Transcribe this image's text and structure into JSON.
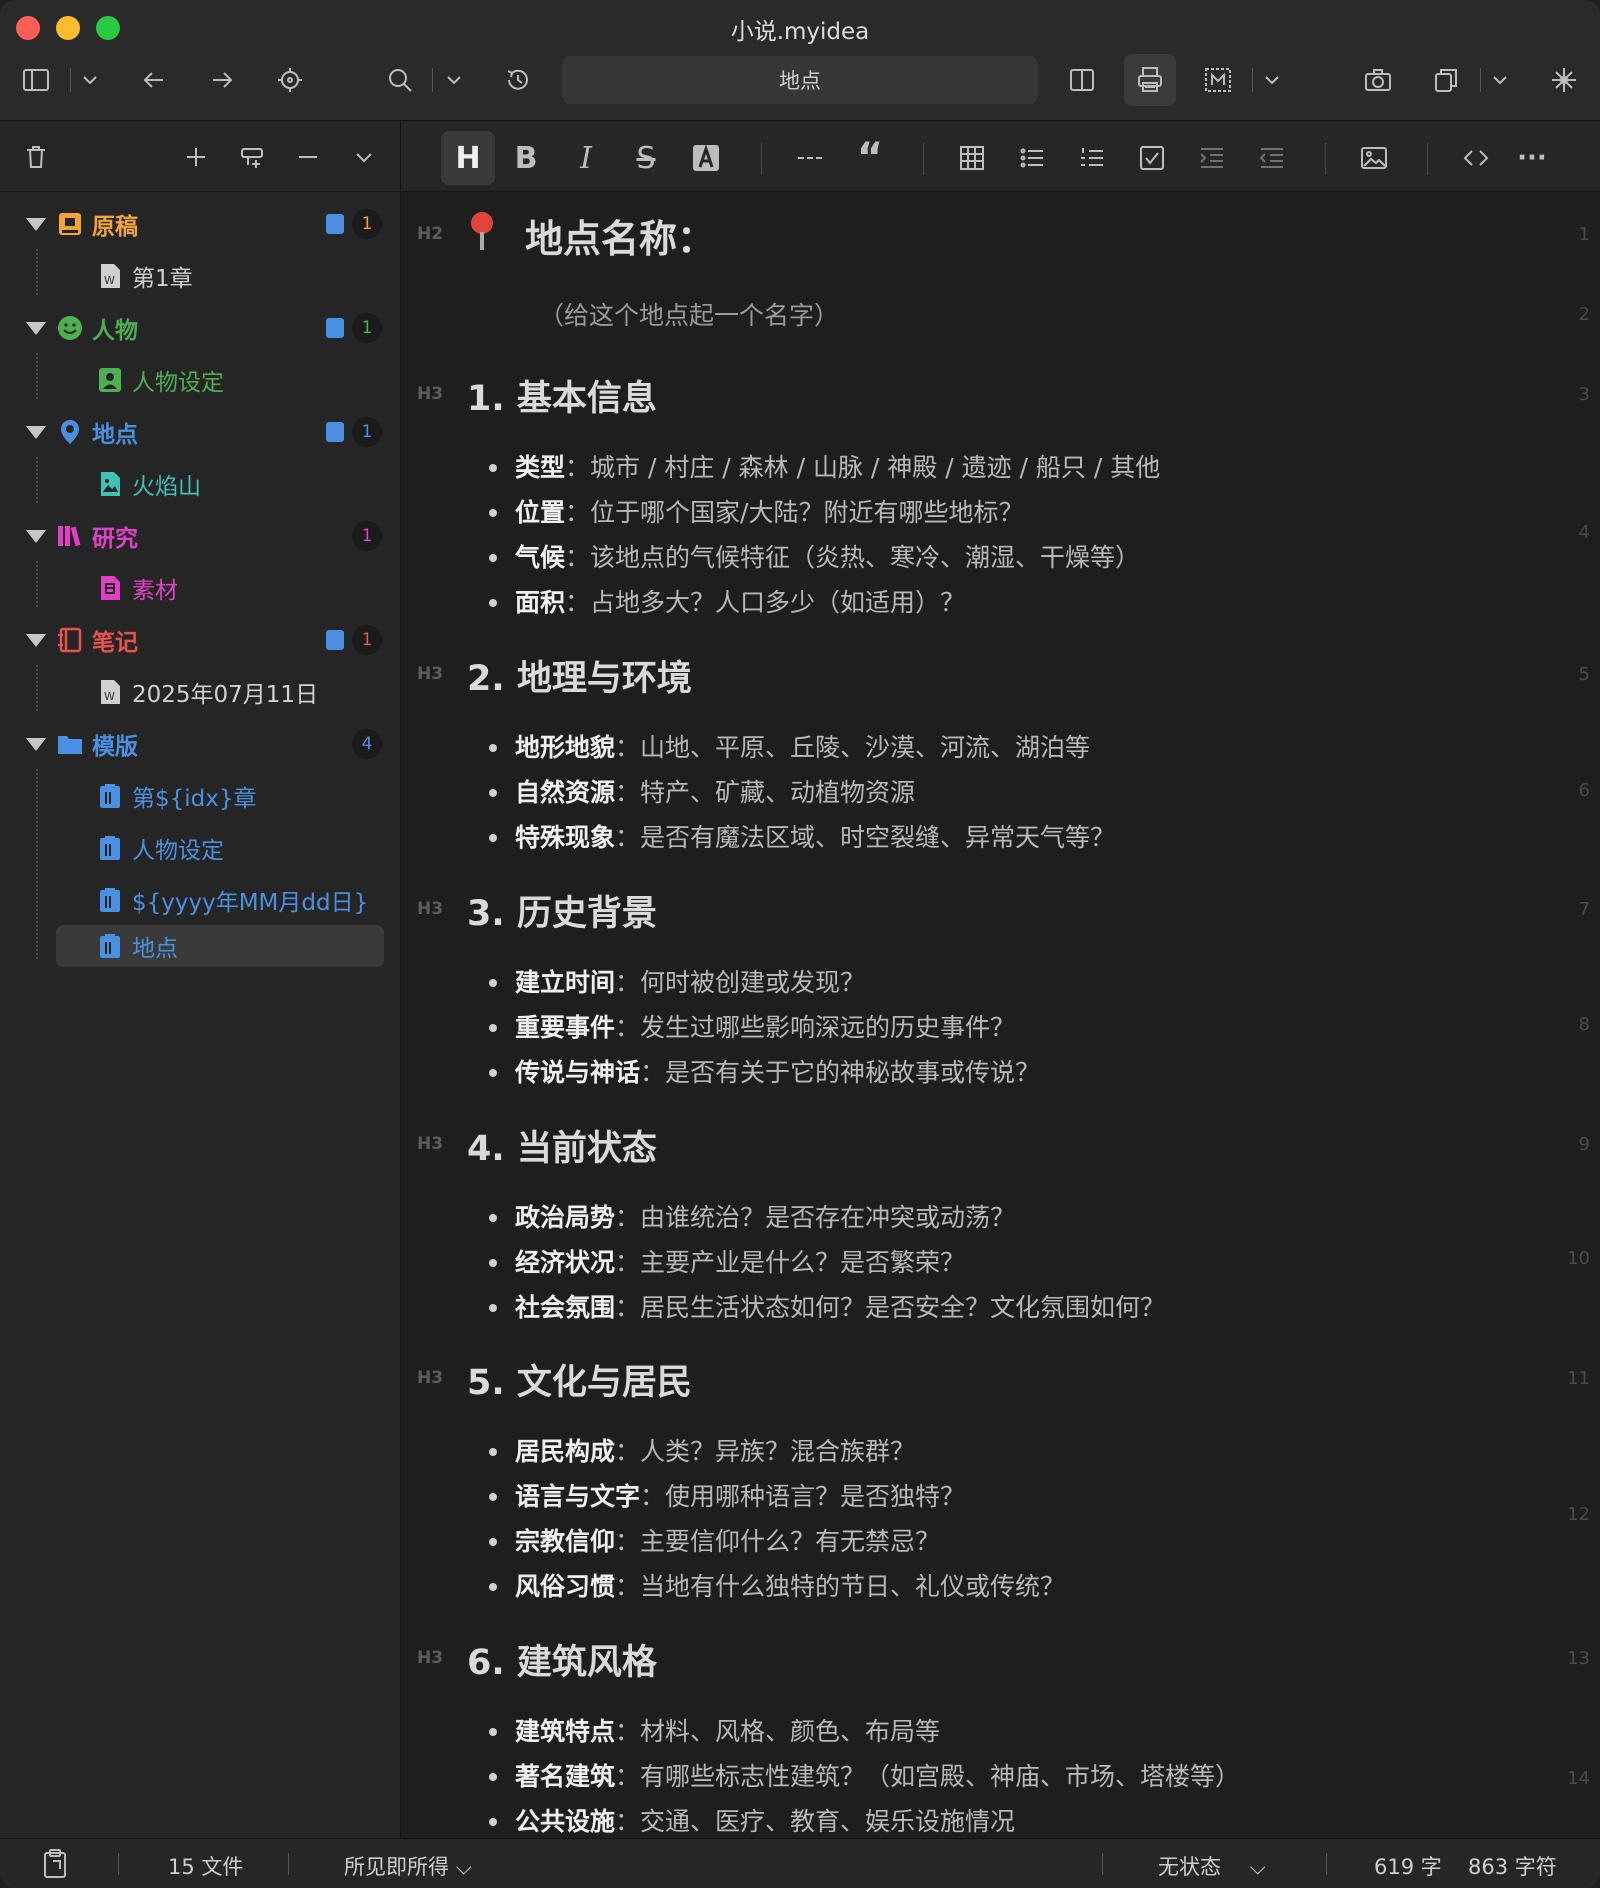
{
  "window": {
    "title": "小说.myidea"
  },
  "toolbar": {
    "search_value": "地点"
  },
  "sidebar": {
    "folders": [
      {
        "label": "原稿",
        "color": "#f2a33a",
        "count": "1",
        "count_color": "#f2a33a",
        "has_note_badge": true,
        "children": [
          {
            "label": "第1章",
            "icon": "doc-icon",
            "color": "#cfcfcf"
          }
        ]
      },
      {
        "label": "人物",
        "color": "#4caf50",
        "count": "1",
        "count_color": "#4caf50",
        "has_note_badge": true,
        "children": [
          {
            "label": "人物设定",
            "icon": "person-icon",
            "color": "#4caf50"
          }
        ]
      },
      {
        "label": "地点",
        "color": "#4a90e2",
        "count": "1",
        "count_color": "#4a90e2",
        "has_note_badge": true,
        "children": [
          {
            "label": "火焰山",
            "icon": "image-icon",
            "color": "#3fc1b5"
          }
        ]
      },
      {
        "label": "研究",
        "color": "#e040c8",
        "count": "1",
        "count_color": "#e040c8",
        "has_note_badge": false,
        "children": [
          {
            "label": "素材",
            "icon": "material-icon",
            "color": "#e040c8"
          }
        ]
      },
      {
        "label": "笔记",
        "color": "#e5534b",
        "count": "1",
        "count_color": "#e5534b",
        "has_note_badge": true,
        "children": [
          {
            "label": "2025年07月11日",
            "icon": "doc-icon",
            "color": "#cfcfcf"
          }
        ]
      },
      {
        "label": "模版",
        "color": "#4a90e2",
        "count": "4",
        "count_color": "#4a90e2",
        "has_note_badge": false,
        "children": [
          {
            "label": "第${idx}章",
            "icon": "template-icon",
            "color": "#4a90e2"
          },
          {
            "label": "人物设定",
            "icon": "template-icon",
            "color": "#4a90e2"
          },
          {
            "label": "${yyyy年MM月dd日}",
            "icon": "template-icon",
            "color": "#4a90e2"
          },
          {
            "label": "地点",
            "icon": "template-icon",
            "color": "#4a90e2",
            "selected": true
          }
        ]
      }
    ]
  },
  "editor": {
    "h2": {
      "marker": "H2",
      "title": "地点名称：",
      "placeholder": "（给这个地点起一个名字）"
    },
    "sections": [
      {
        "marker": "H3",
        "title": "1. 基本信息",
        "items": [
          {
            "key": "类型",
            "value": "城市 / 村庄 / 森林 / 山脉 / 神殿 / 遗迹 / 船只 / 其他"
          },
          {
            "key": "位置",
            "value": "位于哪个国家/大陆？附近有哪些地标？"
          },
          {
            "key": "气候",
            "value": "该地点的气候特征（炎热、寒冷、潮湿、干燥等）"
          },
          {
            "key": "面积",
            "value": "占地多大？人口多少（如适用）？"
          }
        ]
      },
      {
        "marker": "H3",
        "title": "2. 地理与环境",
        "items": [
          {
            "key": "地形地貌",
            "value": "山地、平原、丘陵、沙漠、河流、湖泊等"
          },
          {
            "key": "自然资源",
            "value": "特产、矿藏、动植物资源"
          },
          {
            "key": "特殊现象",
            "value": "是否有魔法区域、时空裂缝、异常天气等？"
          }
        ]
      },
      {
        "marker": "H3",
        "title": "3. 历史背景",
        "items": [
          {
            "key": "建立时间",
            "value": "何时被创建或发现？"
          },
          {
            "key": "重要事件",
            "value": "发生过哪些影响深远的历史事件？"
          },
          {
            "key": "传说与神话",
            "value": "是否有关于它的神秘故事或传说？"
          }
        ]
      },
      {
        "marker": "H3",
        "title": "4. 当前状态",
        "items": [
          {
            "key": "政治局势",
            "value": "由谁统治？是否存在冲突或动荡？"
          },
          {
            "key": "经济状况",
            "value": "主要产业是什么？是否繁荣？"
          },
          {
            "key": "社会氛围",
            "value": "居民生活状态如何？是否安全？文化氛围如何？"
          }
        ]
      },
      {
        "marker": "H3",
        "title": "5. 文化与居民",
        "items": [
          {
            "key": "居民构成",
            "value": "人类？异族？混合族群？"
          },
          {
            "key": "语言与文字",
            "value": "使用哪种语言？是否独特？"
          },
          {
            "key": "宗教信仰",
            "value": "主要信仰什么？有无禁忌？"
          },
          {
            "key": "风俗习惯",
            "value": "当地有什么独特的节日、礼仪或传统？"
          }
        ]
      },
      {
        "marker": "H3",
        "title": "6. 建筑风格",
        "items": [
          {
            "key": "建筑特点",
            "value": "材料、风格、颜色、布局等"
          },
          {
            "key": "著名建筑",
            "value": "有哪些标志性建筑？（如宫殿、神庙、市场、塔楼等）"
          },
          {
            "key": "公共设施",
            "value": "交通、医疗、教育、娱乐设施情况"
          }
        ]
      }
    ],
    "line_numbers": [
      "1",
      "2",
      "3",
      "4",
      "5",
      "6",
      "7",
      "8",
      "9",
      "10",
      "11",
      "12",
      "13",
      "14"
    ]
  },
  "status": {
    "files": "15 文件",
    "mode": "所见即所得",
    "state": "无状态",
    "words": "619 字",
    "chars": "863 字符"
  }
}
